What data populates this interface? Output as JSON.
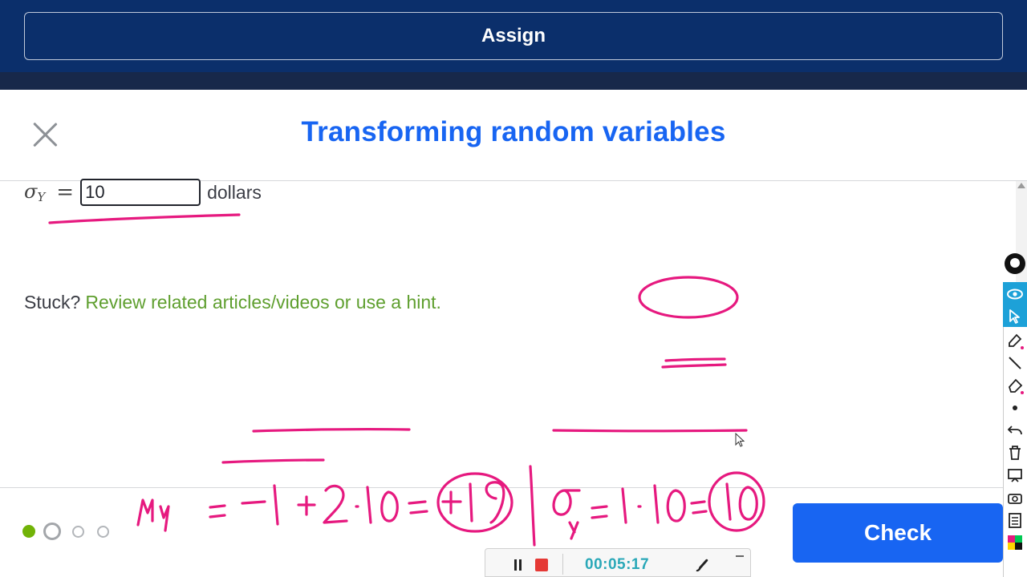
{
  "header": {
    "assign_label": "Assign"
  },
  "modal": {
    "title": "Transforming random variables"
  },
  "question": {
    "symbol": "σ",
    "subscript": "Y",
    "equals": "=",
    "answer_value": "10",
    "unit": "dollars"
  },
  "help": {
    "stuck_label": "Stuck?",
    "link_text": "Review related articles/videos or use a hint."
  },
  "footer": {
    "check_label": "Check",
    "progress": {
      "total": 4,
      "completed": 1,
      "current": 2
    }
  },
  "recorder": {
    "timer": "00:05:17",
    "minimize_label": "–"
  },
  "annotations": {
    "left_expression": "μY = −1 + 2·10 = +19",
    "right_expression": "σY = 1·10 = 10"
  },
  "colors": {
    "brand_blue": "#1865f2",
    "header_navy": "#0b2f6b",
    "link_green": "#5f9f2f",
    "ink_pink": "#e6197f",
    "timer_teal": "#2aa8b8"
  },
  "icons": {
    "close": "close-icon",
    "pause": "pause-icon",
    "stop": "stop-icon",
    "brush": "brush-icon",
    "eye": "eye-icon",
    "pointer": "pointer-icon",
    "pen": "pen-icon",
    "line": "line-icon",
    "eraser": "eraser-icon",
    "undo": "undo-icon",
    "trash": "trash-icon",
    "board": "whiteboard-icon",
    "camera": "camera-icon",
    "notes": "notes-icon"
  }
}
